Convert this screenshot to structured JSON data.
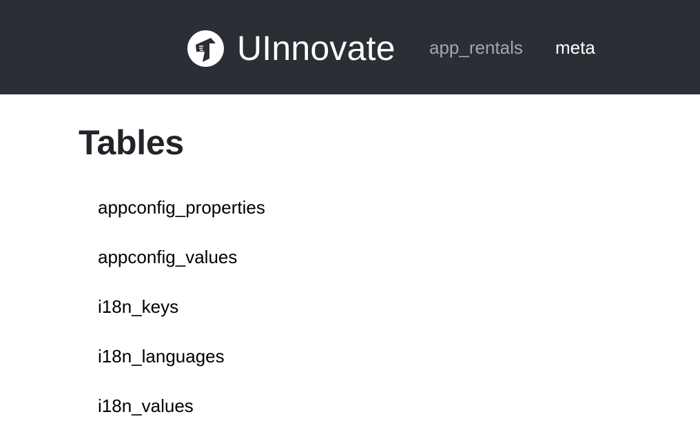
{
  "navbar": {
    "brand_name": "UInnovate",
    "brand_icon": "uinnovate-logo-icon",
    "links": [
      {
        "label": "app_rentals",
        "active": false
      },
      {
        "label": "meta",
        "active": true
      }
    ]
  },
  "main": {
    "title": "Tables",
    "tables": [
      "appconfig_properties",
      "appconfig_values",
      "i18n_keys",
      "i18n_languages",
      "i18n_values"
    ]
  },
  "colors": {
    "navbar_bg": "#2b2e34",
    "nav_link_inactive": "#a3a6ab",
    "nav_link_active": "#ffffff",
    "title_text": "#212529"
  }
}
